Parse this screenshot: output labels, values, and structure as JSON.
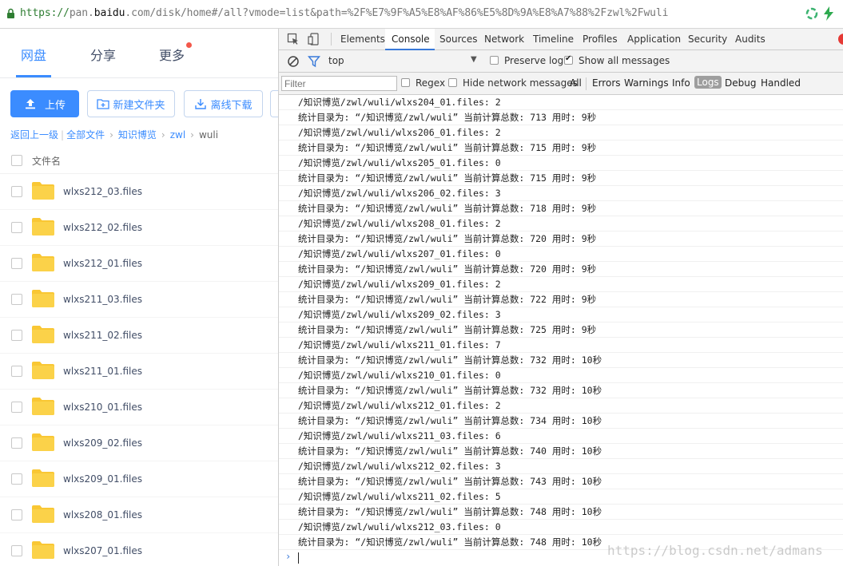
{
  "address_bar": {
    "protocol": "https://",
    "host_prefix": "pan.",
    "host": "baidu",
    "host_suffix": ".com",
    "path": "/disk/home#/all?vmode=list&path=%2F%E7%9F%A5%E8%AF%86%E5%8D%9A%E8%A7%88%2Fzwl%2Fwuli"
  },
  "pan": {
    "nav": [
      "网盘",
      "分享",
      "更多"
    ],
    "buttons": {
      "upload": "上传",
      "new_folder": "新建文件夹",
      "offline_download": "离线下载"
    },
    "breadcrumb": {
      "back": "返回上一级",
      "all_files": "全部文件",
      "level1": "知识博览",
      "level2": "zwl",
      "current": "wuli"
    },
    "column_header": "文件名",
    "files": [
      "wlxs212_03.files",
      "wlxs212_02.files",
      "wlxs212_01.files",
      "wlxs211_03.files",
      "wlxs211_02.files",
      "wlxs211_01.files",
      "wlxs210_01.files",
      "wlxs209_02.files",
      "wlxs209_01.files",
      "wlxs208_01.files",
      "wlxs207_01.files"
    ],
    "colors": {
      "accent": "#3b8cff",
      "folder": "#f9c734"
    }
  },
  "devtools": {
    "tabs": [
      "Elements",
      "Console",
      "Sources",
      "Network",
      "Timeline",
      "Profiles",
      "Application",
      "Security",
      "Audits"
    ],
    "active_tab": "Console",
    "context": "top",
    "preserve_log": "Preserve log",
    "show_all_messages": "Show all messages",
    "filter_placeholder": "Filter",
    "regex": "Regex",
    "hide_network": "Hide network messages",
    "levels": [
      "All",
      "Errors",
      "Warnings",
      "Info",
      "Logs",
      "Debug",
      "Handled"
    ],
    "active_level": "Logs",
    "logs": [
      "/知识博览/zwl/wuli/wlxs204_01.files: 2",
      "统计目录为: “/知识博览/zwl/wuli” 当前计算总数: 713 用时: 9秒",
      "/知识博览/zwl/wuli/wlxs206_01.files: 2",
      "统计目录为: “/知识博览/zwl/wuli” 当前计算总数: 715 用时: 9秒",
      "/知识博览/zwl/wuli/wlxs205_01.files: 0",
      "统计目录为: “/知识博览/zwl/wuli” 当前计算总数: 715 用时: 9秒",
      "/知识博览/zwl/wuli/wlxs206_02.files: 3",
      "统计目录为: “/知识博览/zwl/wuli” 当前计算总数: 718 用时: 9秒",
      "/知识博览/zwl/wuli/wlxs208_01.files: 2",
      "统计目录为: “/知识博览/zwl/wuli” 当前计算总数: 720 用时: 9秒",
      "/知识博览/zwl/wuli/wlxs207_01.files: 0",
      "统计目录为: “/知识博览/zwl/wuli” 当前计算总数: 720 用时: 9秒",
      "/知识博览/zwl/wuli/wlxs209_01.files: 2",
      "统计目录为: “/知识博览/zwl/wuli” 当前计算总数: 722 用时: 9秒",
      "/知识博览/zwl/wuli/wlxs209_02.files: 3",
      "统计目录为: “/知识博览/zwl/wuli” 当前计算总数: 725 用时: 9秒",
      "/知识博览/zwl/wuli/wlxs211_01.files: 7",
      "统计目录为: “/知识博览/zwl/wuli” 当前计算总数: 732 用时: 10秒",
      "/知识博览/zwl/wuli/wlxs210_01.files: 0",
      "统计目录为: “/知识博览/zwl/wuli” 当前计算总数: 732 用时: 10秒",
      "/知识博览/zwl/wuli/wlxs212_01.files: 2",
      "统计目录为: “/知识博览/zwl/wuli” 当前计算总数: 734 用时: 10秒",
      "/知识博览/zwl/wuli/wlxs211_03.files: 6",
      "统计目录为: “/知识博览/zwl/wuli” 当前计算总数: 740 用时: 10秒",
      "/知识博览/zwl/wuli/wlxs212_02.files: 3",
      "统计目录为: “/知识博览/zwl/wuli” 当前计算总数: 743 用时: 10秒",
      "/知识博览/zwl/wuli/wlxs211_02.files: 5",
      "统计目录为: “/知识博览/zwl/wuli” 当前计算总数: 748 用时: 10秒",
      "/知识博览/zwl/wuli/wlxs212_03.files: 0",
      "统计目录为: “/知识博览/zwl/wuli” 当前计算总数: 748 用时: 10秒"
    ],
    "prompt": "›",
    "colors": {
      "active_tab_underline": "#3879d9"
    }
  },
  "watermark": "https://blog.csdn.net/admans"
}
